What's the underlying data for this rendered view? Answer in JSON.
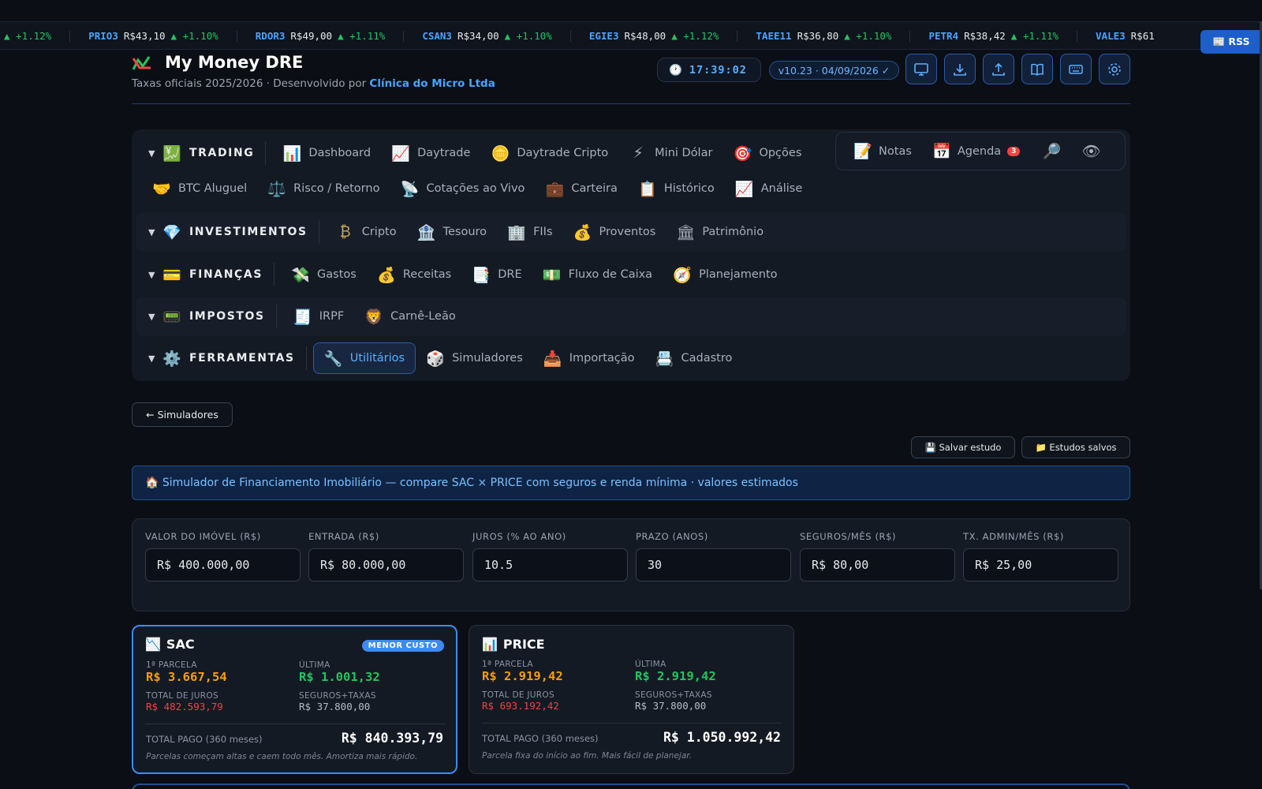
{
  "ticker": [
    {
      "sym": "",
      "price": "",
      "chg": "▲ +1.12%"
    },
    {
      "sym": "PRIO3",
      "price": "R$43,10",
      "chg": "▲ +1.10%"
    },
    {
      "sym": "RDOR3",
      "price": "R$49,00",
      "chg": "▲ +1.11%"
    },
    {
      "sym": "CSAN3",
      "price": "R$34,00",
      "chg": "▲ +1.10%"
    },
    {
      "sym": "EGIE3",
      "price": "R$48,00",
      "chg": "▲ +1.12%"
    },
    {
      "sym": "TAEE11",
      "price": "R$36,80",
      "chg": "▲ +1.10%"
    },
    {
      "sym": "PETR4",
      "price": "R$38,42",
      "chg": "▲ +1.11%"
    },
    {
      "sym": "VALE3",
      "price": "R$61",
      "chg": ""
    }
  ],
  "rss_label": "📰 RSS",
  "header": {
    "title": "My Money DRE",
    "subtitle_prefix": "Taxas oficiais 2025/2026 · Desenvolvido por ",
    "subtitle_company": "Clínica do Micro Ltda",
    "clock": "17:39:02",
    "version": "v10.23 · 04/09/2026 ✓"
  },
  "nav": {
    "trading": {
      "label": "TRADING",
      "items": [
        "Dashboard",
        "Daytrade",
        "Daytrade Cripto",
        "Mini Dólar",
        "Opções",
        "BTC Aluguel",
        "Risco / Retorno",
        "Cotações ao Vivo",
        "Carteira",
        "Histórico",
        "Análise"
      ]
    },
    "investimentos": {
      "label": "INVESTIMENTOS",
      "items": [
        "Cripto",
        "Tesouro",
        "FIIs",
        "Proventos",
        "Patrimônio"
      ]
    },
    "financas": {
      "label": "FINANÇAS",
      "items": [
        "Gastos",
        "Receitas",
        "DRE",
        "Fluxo de Caixa",
        "Planejamento"
      ]
    },
    "impostos": {
      "label": "IMPOSTOS",
      "items": [
        "IRPF",
        "Carnê-Leão"
      ]
    },
    "ferramentas": {
      "label": "FERRAMENTAS",
      "items": [
        "Utilitários",
        "Simuladores",
        "Importação",
        "Cadastro"
      ]
    },
    "quick": {
      "notas": "Notas",
      "agenda": "Agenda",
      "agenda_count": "3"
    }
  },
  "back_label": "← Simuladores",
  "save_label": "💾 Salvar estudo",
  "saved_label": "📁 Estudos salvos",
  "banner": "🏠 Simulador de Financiamento Imobiliário — compare SAC × PRICE com seguros e renda mínima · valores estimados",
  "inputs": [
    {
      "label": "VALOR DO IMÓVEL (R$)",
      "value": "R$ 400.000,00"
    },
    {
      "label": "ENTRADA (R$)",
      "value": "R$ 80.000,00"
    },
    {
      "label": "JUROS (% AO ANO)",
      "value": "10.5"
    },
    {
      "label": "PRAZO (ANOS)",
      "value": "30"
    },
    {
      "label": "SEGUROS/MÊS (R$)",
      "value": "R$ 80,00"
    },
    {
      "label": "TX. ADMIN/MÊS (R$)",
      "value": "R$ 25,00"
    }
  ],
  "sac": {
    "title": "SAC",
    "badge": "MENOR CUSTO",
    "first_label": "1ª PARCELA",
    "first": "R$ 3.667,54",
    "last_label": "ÚLTIMA",
    "last": "R$ 1.001,32",
    "interest_label": "TOTAL DE JUROS",
    "interest": "R$ 482.593,79",
    "fees_label": "SEGUROS+TAXAS",
    "fees": "R$ 37.800,00",
    "total_label": "TOTAL PAGO (360 meses)",
    "total": "R$ 840.393,79",
    "note": "Parcelas começam altas e caem todo mês. Amortiza mais rápido."
  },
  "price": {
    "title": "PRICE",
    "first_label": "1ª PARCELA",
    "first": "R$ 2.919,42",
    "last_label": "ÚLTIMA",
    "last": "R$ 2.919,42",
    "interest_label": "TOTAL DE JUROS",
    "interest": "R$ 693.192,42",
    "fees_label": "SEGUROS+TAXAS",
    "fees": "R$ 37.800,00",
    "total_label": "TOTAL PAGO (360 meses)",
    "total": "R$ 1.050.992,42",
    "note": "Parcela fixa do início ao fim. Mais fácil de planejar."
  },
  "colors": {
    "accent": "#4aa3ff",
    "positive": "#22c55e",
    "warning": "#f59e0b",
    "negative": "#ef4444",
    "background": "#0b0e14"
  }
}
